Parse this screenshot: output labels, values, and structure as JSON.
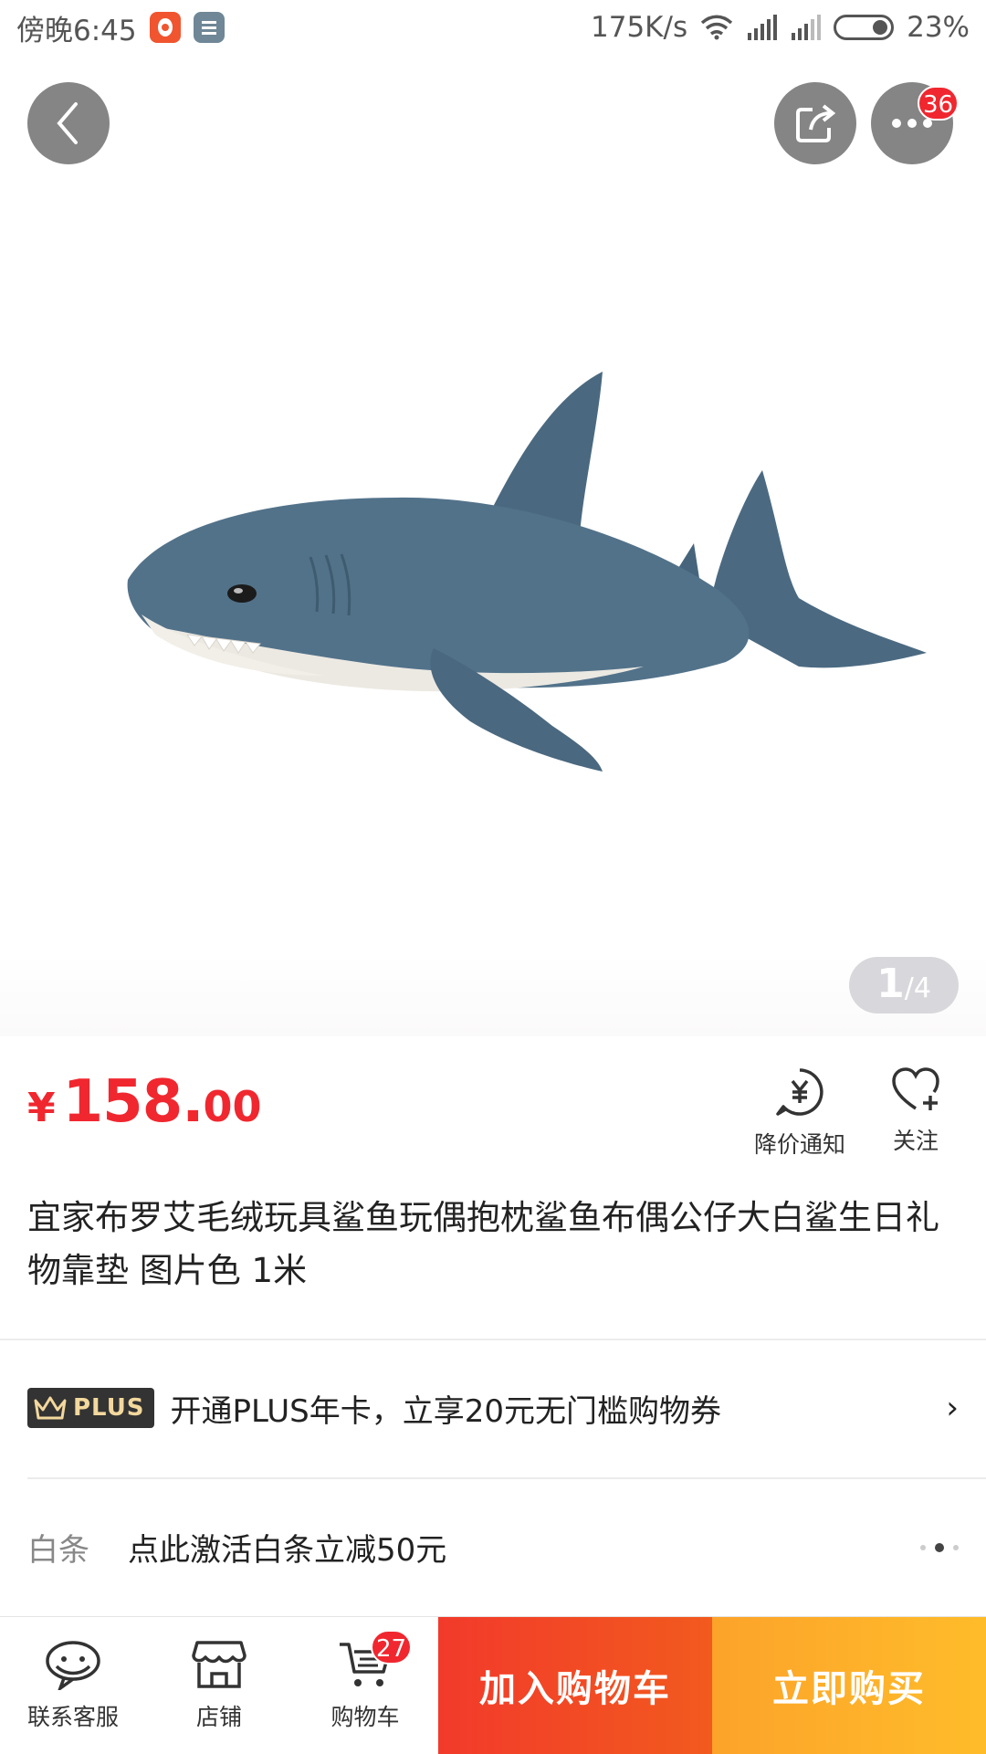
{
  "status_bar": {
    "time": "傍晚6:45",
    "network_speed": "175K/s",
    "battery": "23%"
  },
  "gallery": {
    "current": "1",
    "separator": "/",
    "total": "4",
    "more_badge": "36"
  },
  "product": {
    "currency": "¥",
    "price_int": "158.",
    "price_dec": "00",
    "title": "宜家布罗艾毛绒玩具鲨鱼玩偶抱枕鲨鱼布偶公仔大白鲨生日礼物靠垫  图片色  1米"
  },
  "actions": {
    "price_alert": "降价通知",
    "follow": "关注"
  },
  "plus": {
    "badge": "PLUS",
    "text": "开通PLUS年卡，立享20元无门槛购物券",
    "chevron": "›"
  },
  "baitiao": {
    "label": "白条",
    "text": "点此激活白条立减50元"
  },
  "bottom_bar": {
    "service": "联系客服",
    "shop": "店铺",
    "cart": "购物车",
    "cart_badge": "27",
    "add_to_cart": "加入购物车",
    "buy_now": "立即购买"
  },
  "colors": {
    "price_red": "#f0272f",
    "cart_button": "#f23a2b",
    "buy_button": "#fca32a",
    "shark_body": "#4c6a80"
  }
}
